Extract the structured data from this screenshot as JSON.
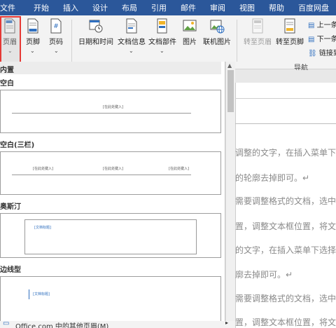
{
  "tabs": [
    "文件",
    "开始",
    "插入",
    "设计",
    "布局",
    "引用",
    "邮件",
    "审阅",
    "视图",
    "帮助",
    "百度网盘"
  ],
  "ribbon": {
    "header_btn": "页眉",
    "footer_btn": "页脚",
    "pagenum_btn": "页码",
    "datetime_btn": "日期和时间",
    "docinfo_btn": "文档信息",
    "docparts_btn": "文档部件",
    "picture_btn": "图片",
    "online_picture_btn": "联机图片",
    "goto_header_btn": "转至页眉",
    "goto_footer_btn": "转至页脚",
    "prev_cmd": "上一条",
    "next_cmd": "下一条",
    "link_prev_cmd": "链接到",
    "nav_group_label": "导航"
  },
  "gallery": {
    "builtin_label": "内置",
    "sections": [
      {
        "title": "空白",
        "placeholders": [
          "[在此处键入]"
        ]
      },
      {
        "title": "空白(三栏)",
        "placeholders": [
          "[在此处键入]",
          "[在此处键入]",
          "[在此处键入]"
        ]
      },
      {
        "title": "奥斯汀",
        "placeholders": [
          "[文档标题]"
        ]
      },
      {
        "title": "边线型",
        "placeholders": [
          "[文档标题]"
        ]
      }
    ],
    "footer_link": "Office.com 中的其他页眉(M)"
  },
  "document": {
    "lines": [
      "调整的文字，在插入菜单下选",
      "的轮廓去掉即可。↵",
      "需要调整格式的文档，选中需",
      "置，调整文本框位置，将文本",
      "的文字，在插入菜单下选择文",
      "廓去掉即可。↵",
      "需要调整格式的文档，选中需",
      "置，调整文本框位置，将文本"
    ]
  },
  "colors": {
    "tab_bar": "#2b579a",
    "ribbon_bg": "#f3f3f3",
    "highlight_border": "#e53935",
    "accent_blue": "#2f6fbf",
    "doc_text": "#8a8a8a"
  }
}
